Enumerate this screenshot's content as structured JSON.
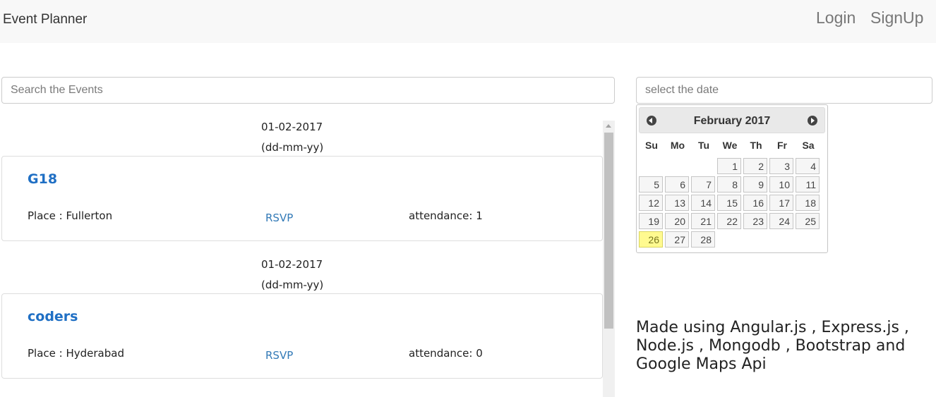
{
  "navbar": {
    "brand": "Event Planner",
    "login": "Login",
    "signup": "SignUp"
  },
  "search": {
    "placeholder": "Search the Events",
    "value": ""
  },
  "date_picker": {
    "placeholder": "select the date",
    "value": ""
  },
  "events": [
    {
      "date": "01-02-2017",
      "date_format": "(dd-mm-yy)",
      "title": "G18",
      "place": "Place : Fullerton",
      "rsvp": "RSVP",
      "attendance": "attendance: 1"
    },
    {
      "date": "01-02-2017",
      "date_format": "(dd-mm-yy)",
      "title": "coders",
      "place": "Place : Hyderabad",
      "rsvp": "RSVP",
      "attendance": "attendance: 0"
    }
  ],
  "calendar": {
    "title": "February 2017",
    "prev_icon": "circle-triangle-w-icon",
    "next_icon": "circle-triangle-e-icon",
    "weekdays": [
      "Su",
      "Mo",
      "Tu",
      "We",
      "Th",
      "Fr",
      "Sa"
    ],
    "first_weekday_index": 3,
    "days_in_month": 28,
    "highlighted_day": 26,
    "highlight_color": "#fffa90"
  },
  "credits": "Made using Angular.js , Express.js , Node.js , Mongodb , Bootstrap and Google Maps Api",
  "colors": {
    "link": "#337ab7",
    "event_title": "#1f6fc4",
    "navbar_bg": "#f8f8f8"
  }
}
